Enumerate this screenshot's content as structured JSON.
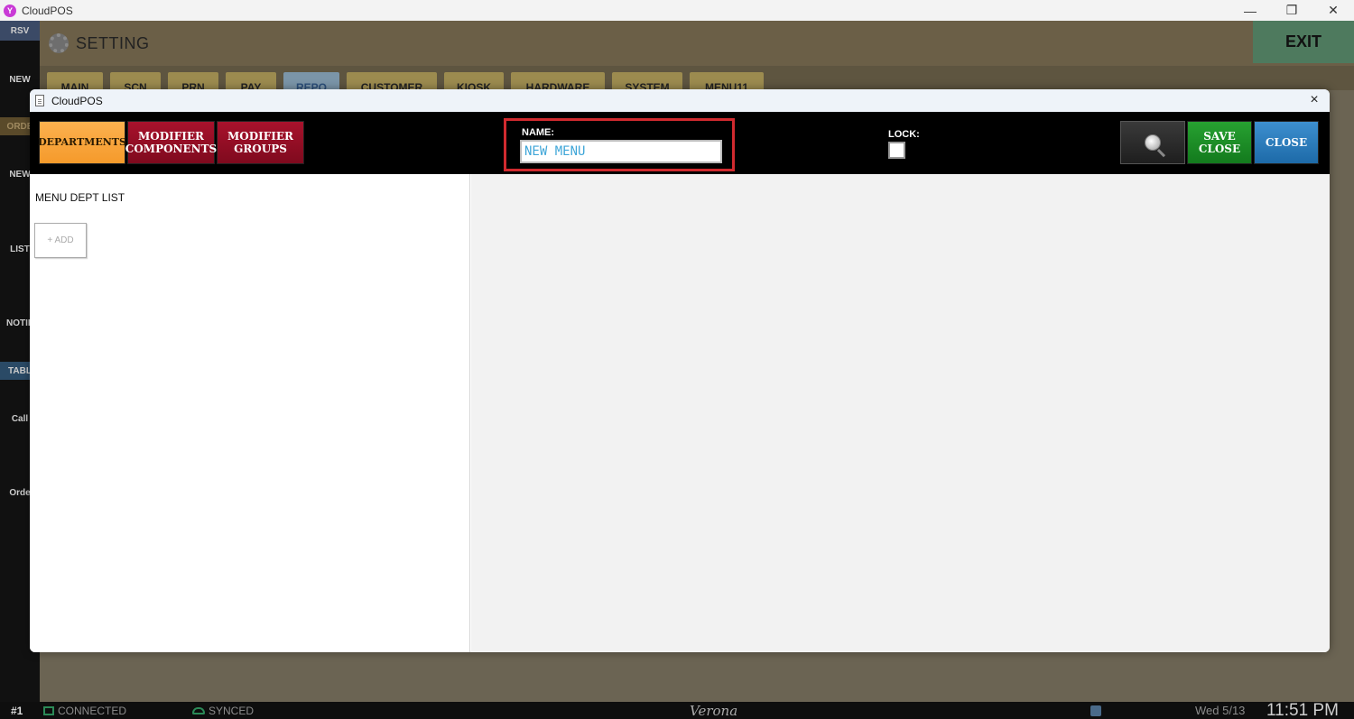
{
  "os_window": {
    "title": "CloudPOS",
    "app_icon_letter": "Y",
    "controls": {
      "minimize": "—",
      "restore": "❐",
      "close": "✕"
    }
  },
  "background_app": {
    "sidebar": [
      "RSV",
      "NEW",
      "ORDE",
      "NEW",
      "LIST",
      "NOTIF",
      "TABL",
      "Call",
      "Orde"
    ],
    "header_title": "SETTING",
    "exit_label": "EXIT",
    "tabs": [
      {
        "label": "MAIN",
        "active": false
      },
      {
        "label": "SCN",
        "active": false
      },
      {
        "label": "PRN",
        "active": false
      },
      {
        "label": "PAY",
        "active": false
      },
      {
        "label": "REPO",
        "active": true
      },
      {
        "label": "CUSTOMER",
        "active": false
      },
      {
        "label": "KIOSK",
        "active": false
      },
      {
        "label": "HARDWARE",
        "active": false
      },
      {
        "label": "SYSTEM",
        "active": false
      },
      {
        "label": "MENU11",
        "active": false
      }
    ]
  },
  "modal": {
    "title": "CloudPOS",
    "close_icon": "×",
    "toolbar": {
      "departments": "DEPARTMENTS",
      "modifier_components": [
        "MODIFIER",
        "COMPONENTS"
      ],
      "modifier_groups": [
        "MODIFIER",
        "GROUPS"
      ],
      "name_label": "NAME:",
      "name_value": "NEW MENU",
      "lock_label": "LOCK:",
      "lock_checked": false,
      "save_close": [
        "SAVE",
        "CLOSE"
      ],
      "close": "CLOSE"
    },
    "left_panel": {
      "title": "MENU DEPT LIST",
      "add_label": "+ ADD"
    }
  },
  "statusbar": {
    "terminal": "#1",
    "connected": "CONNECTED",
    "synced": "SYNCED",
    "location": "Verona",
    "date": "Wed 5/13",
    "time": "11:51 PM"
  },
  "colors": {
    "departments_button": "#f7a33a",
    "modifier_button": "#951028",
    "save_button": "#1f8f28",
    "close_button": "#2a7dbf",
    "highlight_box": "#d12a2f",
    "name_text": "#3fa6d8"
  }
}
